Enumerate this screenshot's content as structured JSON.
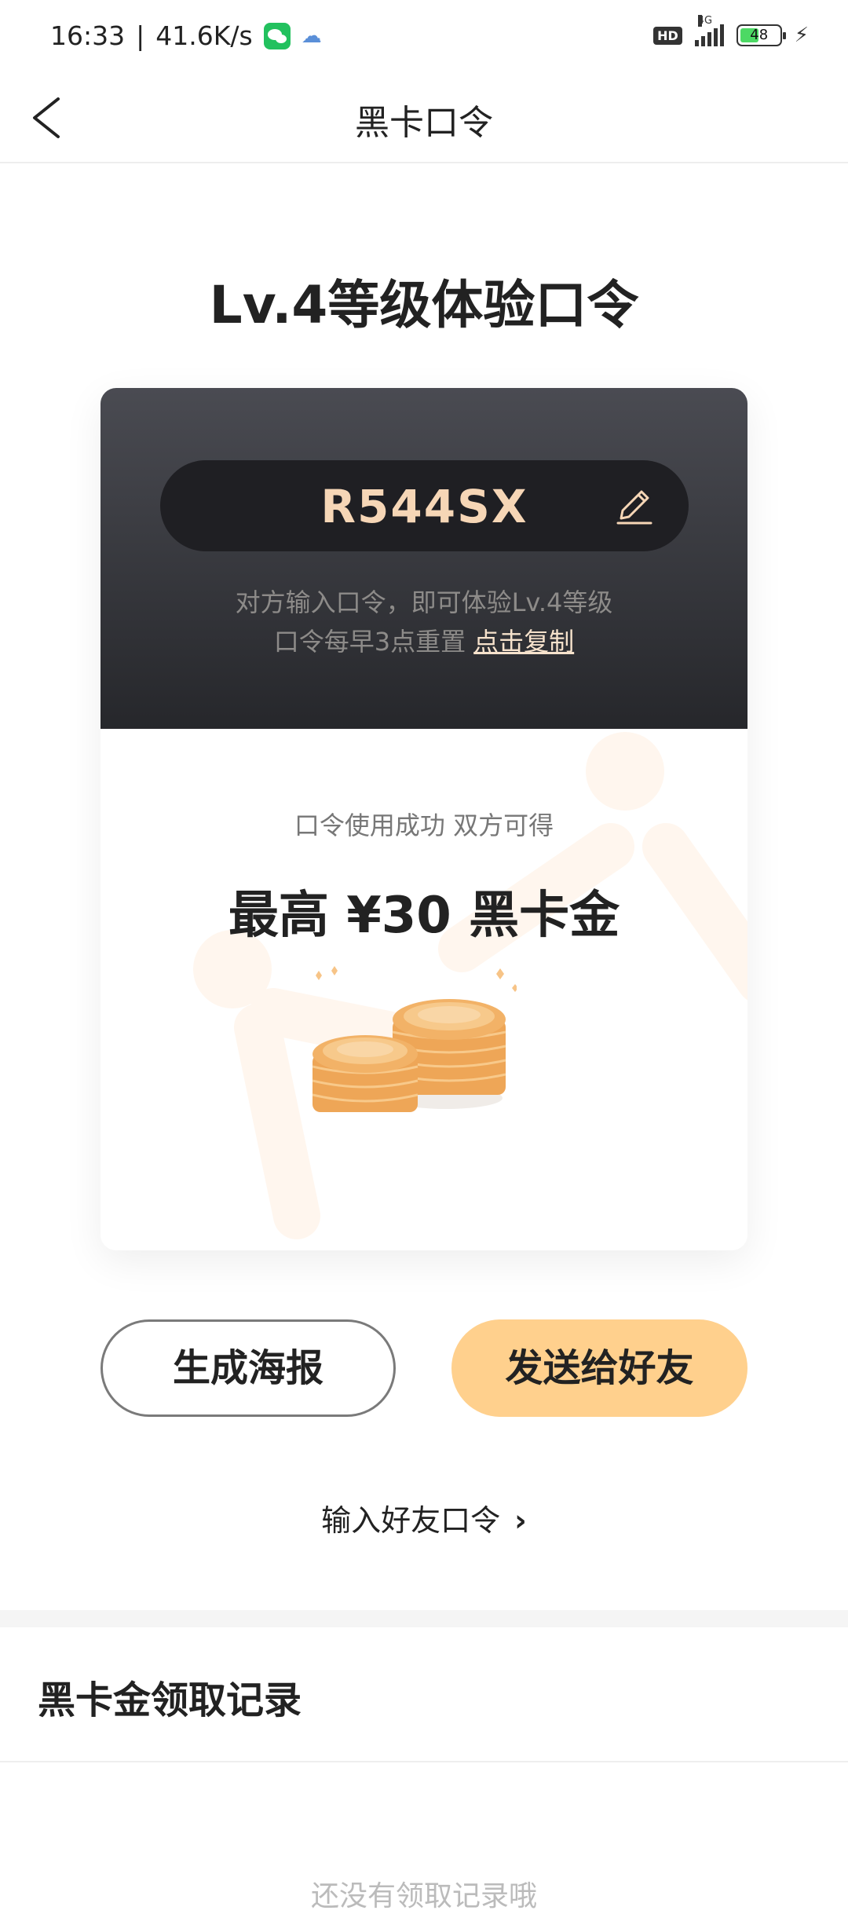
{
  "status_bar": {
    "time": "16:33",
    "speed": "41.6K/s",
    "hd": "HD",
    "network": "4G",
    "battery": "48",
    "battery_level": 0.48
  },
  "header": {
    "title": "黑卡口令"
  },
  "main": {
    "title": "Lv.4等级体验口令",
    "code": "R544SX",
    "desc_line1": "对方输入口令，即可体验Lv.4等级",
    "desc_line2": "口令每早3点重置",
    "copy_link": "点击复制",
    "success_text": "口令使用成功 双方可得",
    "reward_text": "最高 ¥30 黑卡金"
  },
  "buttons": {
    "poster": "生成海报",
    "send": "发送给好友"
  },
  "enter_code": {
    "label": "输入好友口令",
    "chevron": "›"
  },
  "records": {
    "title": "黑卡金领取记录",
    "empty": "还没有领取记录哦"
  },
  "colors": {
    "accent": "#ffd08d",
    "card_dark": "#26272b",
    "code_text": "#f6d6b6"
  }
}
